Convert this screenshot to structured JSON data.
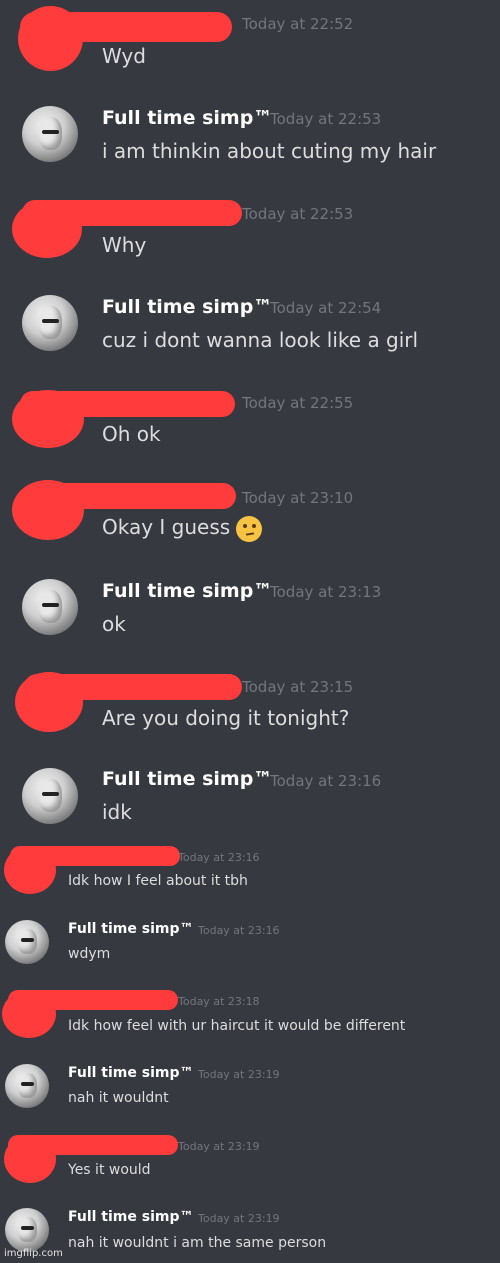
{
  "messages": [
    {
      "author": "",
      "time": "Today at 22:52",
      "text": "Wyd"
    },
    {
      "author": "Full time simp™",
      "time": "Today at 22:53",
      "text": "i am thinkin about cuting my hair"
    },
    {
      "author": "",
      "time": "Today at 22:53",
      "text": "Why"
    },
    {
      "author": "Full time simp™",
      "time": "Today at 22:54",
      "text": "cuz i dont wanna look like a girl"
    },
    {
      "author": "",
      "time": "Today at 22:55",
      "text": "Oh ok"
    },
    {
      "author": "",
      "time": "Today at 23:10",
      "text": "Okay I guess",
      "emoji": "thinking-face"
    },
    {
      "author": "Full time simp™",
      "time": "Today at 23:13",
      "text": "ok"
    },
    {
      "author": "",
      "time": "Today at 23:15",
      "text": "Are you doing it tonight?"
    },
    {
      "author": "Full time simp™",
      "time": "Today at 23:16",
      "text": "idk"
    },
    {
      "author": "",
      "time": "Today at 23:16",
      "text": "Idk how I feel about it tbh"
    },
    {
      "author": "Full time simp™",
      "time": "Today at 23:16",
      "text": "wdym"
    },
    {
      "author": "",
      "time": "Today at 23:18",
      "text": "Idk how feel with ur haircut it would be different"
    },
    {
      "author": "Full time simp™",
      "time": "Today at 23:19",
      "text": "nah it wouldnt"
    },
    {
      "author": "",
      "time": "Today at 23:19",
      "text": "Yes it would"
    },
    {
      "author": "Full time simp™",
      "time": "Today at 23:19",
      "text": "nah it wouldnt i am the same person"
    }
  ],
  "watermark": "imgflip.com",
  "colors": {
    "background": "#36393f",
    "redaction": "#ff3b3b",
    "username": "#ffffff",
    "timestamp": "#72767d",
    "message": "#dcddde"
  }
}
